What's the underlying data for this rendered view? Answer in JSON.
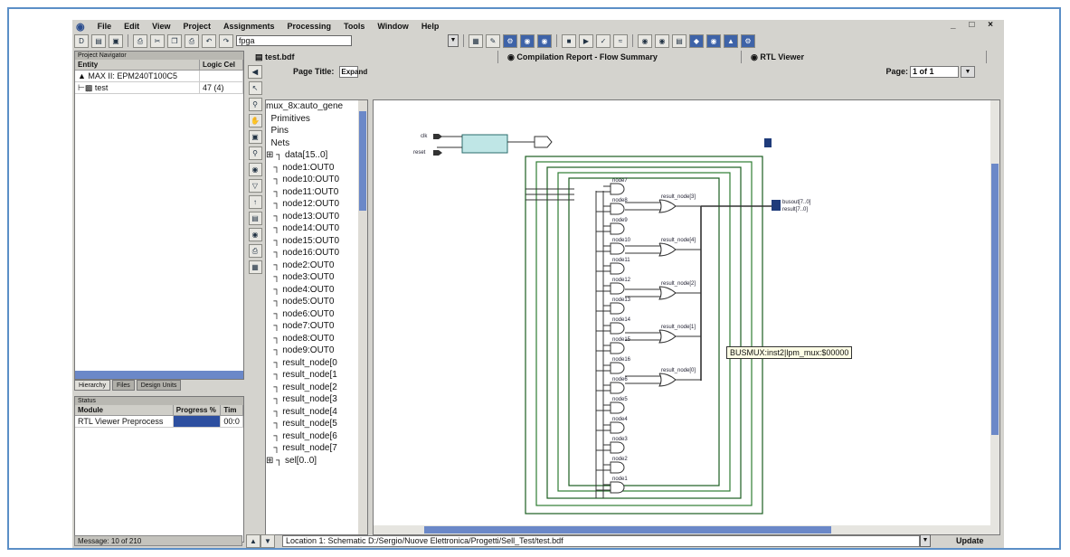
{
  "menu": {
    "items": [
      "File",
      "Edit",
      "View",
      "Project",
      "Assignments",
      "Processing",
      "Tools",
      "Window",
      "Help"
    ]
  },
  "toolbar": {
    "project_name": "fpga"
  },
  "project_navigator": {
    "title": "Project Navigator",
    "columns": [
      "Entity",
      "Logic Cel"
    ],
    "rows": [
      {
        "entity": "MAX II: EPM240T100C5",
        "cells": ""
      },
      {
        "entity": "test",
        "cells": "47 (4)"
      }
    ],
    "tabs": [
      "Hierarchy",
      "Files",
      "Design Units"
    ]
  },
  "status_panel": {
    "title": "Status",
    "columns": [
      "Module",
      "Progress %",
      "Tim"
    ],
    "rows": [
      {
        "module": "RTL Viewer Preprocess",
        "progress": "",
        "time": "00:0"
      }
    ]
  },
  "doc_tabs": [
    "test.bdf",
    "Compilation Report - Flow Summary",
    "RTL Viewer"
  ],
  "page_bar": {
    "page_title_label": "Page Title:",
    "page_title_value": "Expand",
    "page_label": "Page:",
    "page_value": "1 of 1"
  },
  "netlist_tree": [
    "mux_8x:auto_gene",
    "Primitives",
    "Pins",
    "Nets",
    "data[15..0]",
    "node1:OUT0",
    "node10:OUT0",
    "node11:OUT0",
    "node12:OUT0",
    "node13:OUT0",
    "node14:OUT0",
    "node15:OUT0",
    "node16:OUT0",
    "node2:OUT0",
    "node3:OUT0",
    "node4:OUT0",
    "node5:OUT0",
    "node6:OUT0",
    "node7:OUT0",
    "node8:OUT0",
    "node9:OUT0",
    "result_node[0",
    "result_node[1",
    "result_node[2",
    "result_node[3",
    "result_node[4",
    "result_node[5",
    "result_node[6",
    "result_node[7",
    "sel[0..0]"
  ],
  "schematic": {
    "tooltip": "BUSMUX:inst2|lpm_mux:$00000",
    "gate_labels": [
      "node7",
      "node8",
      "node9",
      "node10",
      "node11",
      "node12",
      "node13",
      "node14",
      "node15",
      "node16",
      "node6",
      "node5",
      "node4",
      "node3",
      "node2",
      "node1"
    ],
    "result_labels": [
      "result_node[3]",
      "result_node[4]",
      "result_node[2]",
      "result_node[1]",
      "result_node[0]"
    ],
    "outputs": [
      "busout[7..0]",
      "result[7..0]"
    ],
    "inputs": [
      "clk",
      "reset"
    ]
  },
  "location_bar": {
    "text": "Location 1: Schematic D:/Sergio/Nuove Elettronica/Progetti/Sell_Test/test.bdf",
    "update_label": "Update"
  },
  "message_bar": {
    "text": "Message: 10 of 210"
  }
}
